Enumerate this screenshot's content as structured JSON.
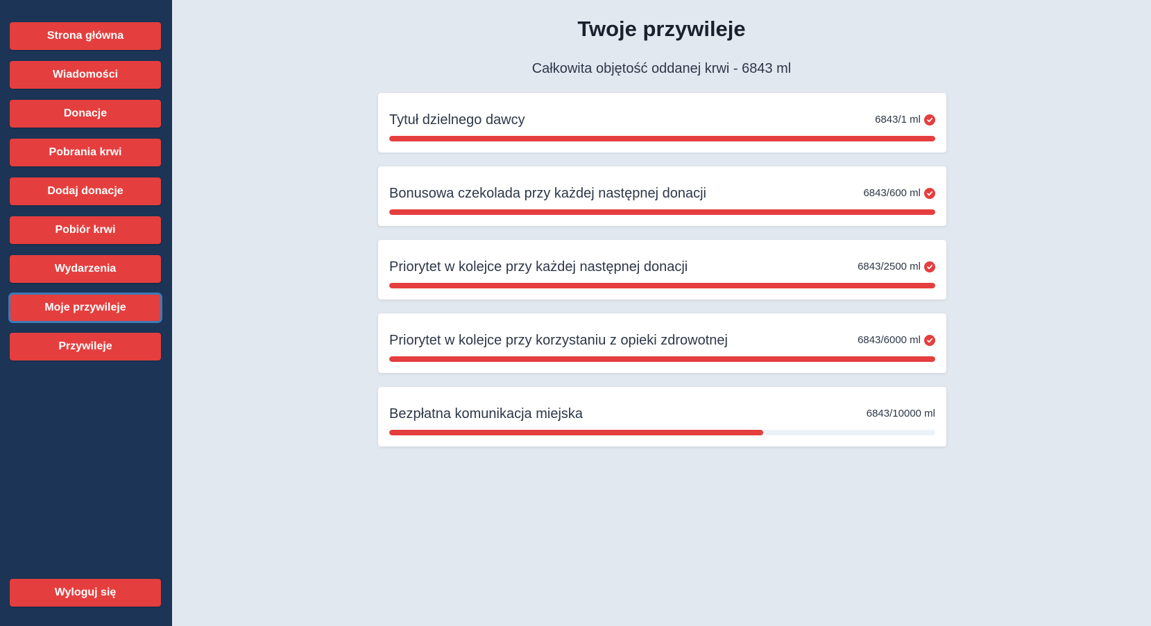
{
  "sidebar": {
    "items": [
      {
        "label": "Strona główna"
      },
      {
        "label": "Wiadomości"
      },
      {
        "label": "Donacje"
      },
      {
        "label": "Pobrania krwi"
      },
      {
        "label": "Dodaj donacje"
      },
      {
        "label": "Pobiór krwi"
      },
      {
        "label": "Wydarzenia"
      },
      {
        "label": "Moje przywileje",
        "active": true
      },
      {
        "label": "Przywileje"
      }
    ],
    "logout_label": "Wyloguj się"
  },
  "main": {
    "title": "Twoje przywileje",
    "total_text": "Całkowita objętość oddanej krwi - 6843 ml",
    "privileges": [
      {
        "title": "Tytuł dzielnego dawcy",
        "progress_text": "6843/1 ml",
        "progress": 1.0,
        "achieved": true
      },
      {
        "title": "Bonusowa czekolada przy każdej następnej donacji",
        "progress_text": "6843/600 ml",
        "progress": 1.0,
        "achieved": true
      },
      {
        "title": "Priorytet w kolejce przy każdej następnej donacji",
        "progress_text": "6843/2500 ml",
        "progress": 1.0,
        "achieved": true
      },
      {
        "title": "Priorytet w kolejce przy korzystaniu z opieki zdrowotnej",
        "progress_text": "6843/6000 ml",
        "progress": 1.0,
        "achieved": true
      },
      {
        "title": "Bezpłatna komunikacja miejska",
        "progress_text": "6843/10000 ml",
        "progress": 0.6843,
        "achieved": false
      }
    ]
  },
  "colors": {
    "sidebar_bg": "#1c3557",
    "accent_red": "#e53e3e",
    "page_bg": "#e2e8f0"
  },
  "icons": {
    "achieved": "check-circle-icon"
  }
}
